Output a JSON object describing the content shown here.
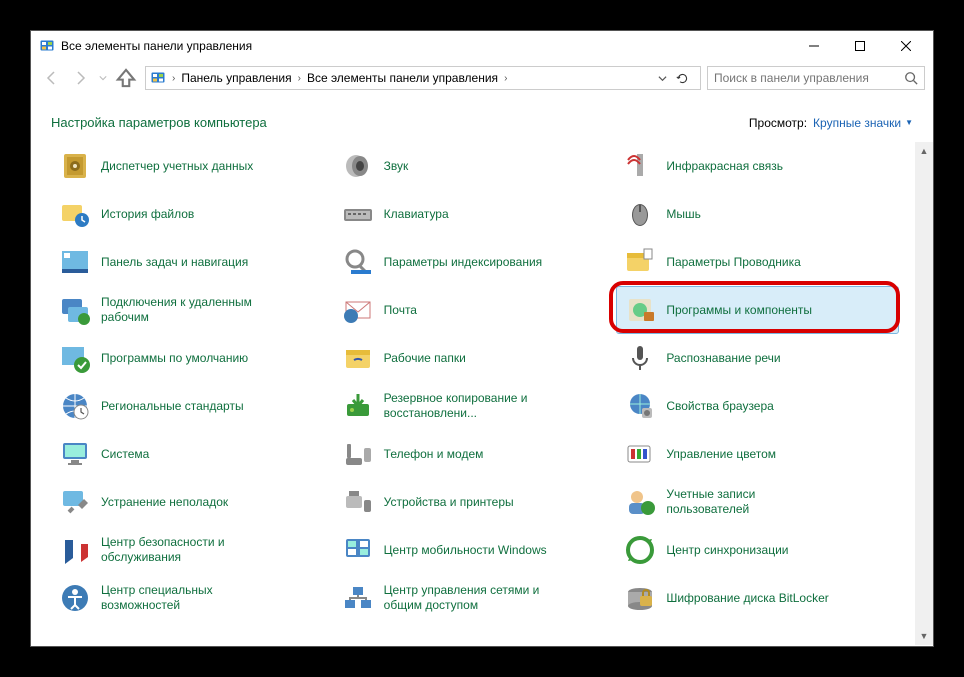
{
  "window": {
    "title": "Все элементы панели управления"
  },
  "breadcrumb": {
    "seg1": "Панель управления",
    "seg2": "Все элементы панели управления"
  },
  "search": {
    "placeholder": "Поиск в панели управления"
  },
  "header": {
    "title": "Настройка параметров компьютера",
    "view_label": "Просмотр:",
    "view_value": "Крупные значки"
  },
  "items": [
    {
      "label": "Диспетчер учетных данных",
      "icon": "#ico-safe"
    },
    {
      "label": "Звук",
      "icon": "#ico-speaker"
    },
    {
      "label": "Инфракрасная связь",
      "icon": "#ico-infrared"
    },
    {
      "label": "История файлов",
      "icon": "#ico-history"
    },
    {
      "label": "Клавиатура",
      "icon": "#ico-keyboard"
    },
    {
      "label": "Мышь",
      "icon": "#ico-mouse"
    },
    {
      "label": "Панель задач и навигация",
      "icon": "#ico-taskbar"
    },
    {
      "label": "Параметры индексирования",
      "icon": "#ico-index"
    },
    {
      "label": "Параметры Проводника",
      "icon": "#ico-explorer"
    },
    {
      "label": "Подключения к удаленным рабочим",
      "icon": "#ico-remote"
    },
    {
      "label": "Почта",
      "icon": "#ico-mail"
    },
    {
      "label": "Программы и компоненты",
      "icon": "#ico-programs",
      "highlighted": true
    },
    {
      "label": "Программы по умолчанию",
      "icon": "#ico-default"
    },
    {
      "label": "Рабочие папки",
      "icon": "#ico-workfolders"
    },
    {
      "label": "Распознавание речи",
      "icon": "#ico-speech"
    },
    {
      "label": "Региональные стандарты",
      "icon": "#ico-region"
    },
    {
      "label": "Резервное копирование и восстановлени...",
      "icon": "#ico-backup"
    },
    {
      "label": "Свойства браузера",
      "icon": "#ico-inet"
    },
    {
      "label": "Система",
      "icon": "#ico-system"
    },
    {
      "label": "Телефон и модем",
      "icon": "#ico-phone"
    },
    {
      "label": "Управление цветом",
      "icon": "#ico-color"
    },
    {
      "label": "Устранение неполадок",
      "icon": "#ico-trouble"
    },
    {
      "label": "Устройства и принтеры",
      "icon": "#ico-devices"
    },
    {
      "label": "Учетные записи пользователей",
      "icon": "#ico-users"
    },
    {
      "label": "Центр безопасности и обслуживания",
      "icon": "#ico-security"
    },
    {
      "label": "Центр мобильности Windows",
      "icon": "#ico-mobility"
    },
    {
      "label": "Центр синхронизации",
      "icon": "#ico-sync"
    },
    {
      "label": "Центр специальных возможностей",
      "icon": "#ico-ease"
    },
    {
      "label": "Центр управления сетями и общим доступом",
      "icon": "#ico-network"
    },
    {
      "label": "Шифрование диска BitLocker",
      "icon": "#ico-bitlocker"
    }
  ]
}
